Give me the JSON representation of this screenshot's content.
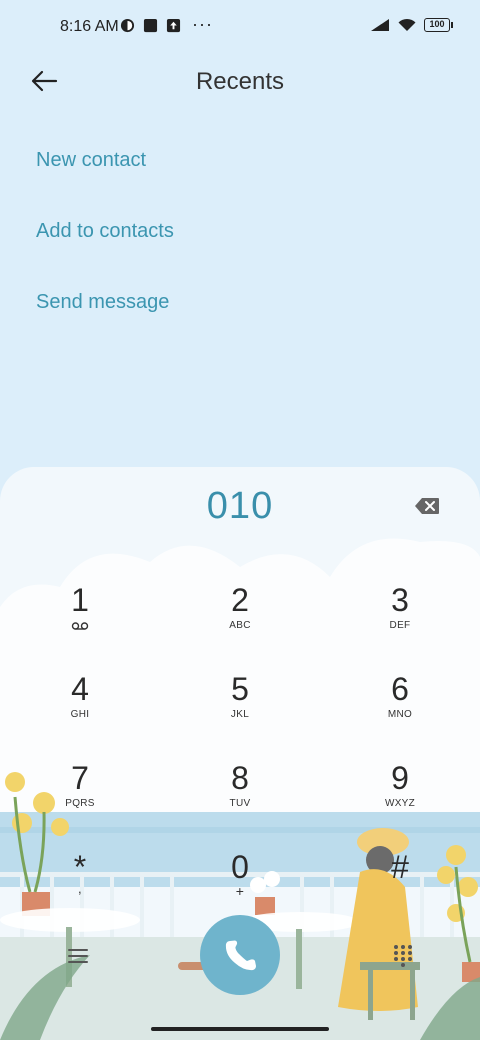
{
  "status_bar": {
    "time": "8:16 AM",
    "dots": "···",
    "battery": "100",
    "icons": [
      "sync-icon",
      "square-app-icon",
      "upload-icon",
      "signal-icon",
      "wifi-icon",
      "battery-icon"
    ]
  },
  "header": {
    "title": "Recents",
    "back_icon": "arrow-left-icon"
  },
  "menu": {
    "items": [
      {
        "label": "New contact"
      },
      {
        "label": "Add to contacts"
      },
      {
        "label": "Send message"
      }
    ]
  },
  "dialer": {
    "number": "010",
    "keys": [
      {
        "digit": "1",
        "letters": ""
      },
      {
        "digit": "2",
        "letters": "ABC"
      },
      {
        "digit": "3",
        "letters": "DEF"
      },
      {
        "digit": "4",
        "letters": "GHI"
      },
      {
        "digit": "5",
        "letters": "JKL"
      },
      {
        "digit": "6",
        "letters": "MNO"
      },
      {
        "digit": "7",
        "letters": "PQRS"
      },
      {
        "digit": "8",
        "letters": "TUV"
      },
      {
        "digit": "9",
        "letters": "WXYZ"
      },
      {
        "digit": "*",
        "letters": ","
      },
      {
        "digit": "0",
        "letters": "+"
      },
      {
        "digit": "#",
        "letters": ""
      }
    ],
    "accent_color": "#3a8fab",
    "call_button_color": "#6fb4cc"
  }
}
